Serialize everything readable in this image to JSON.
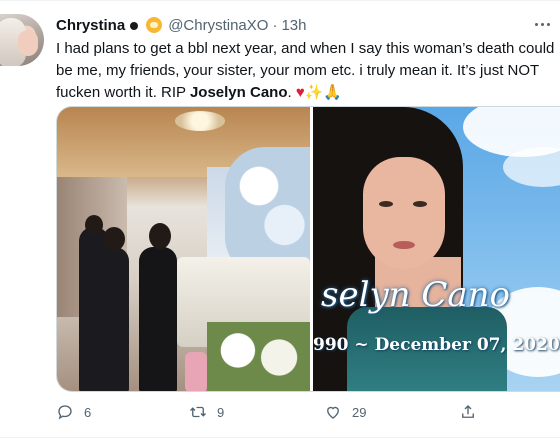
{
  "tweet": {
    "author_name": "Chrystina",
    "author_handle": "@ChrystinaXO",
    "separator": "·",
    "timestamp": "13h",
    "text_part1": "I had plans to get a bbl next year, and when I say this woman’s death could be me, my friends, your sister, your mom etc. i truly mean it. It’s just NOT fucken worth it. RIP ",
    "text_bold_name": "Joselyn Cano",
    "text_end": ". ",
    "emoji_heart": "♥",
    "emoji_sparkles": "✨",
    "emoji_pray": "🙏",
    "media": {
      "image2_overlay_name": "selyn Cano",
      "image2_overlay_dates": "990 ~ December 07, 2020"
    },
    "actions": {
      "reply_count": "6",
      "retweet_count": "9",
      "like_count": "29"
    },
    "icons": {
      "reply": "reply-icon",
      "retweet": "retweet-icon",
      "like": "like-icon",
      "share": "share-icon",
      "more": "more-icon"
    },
    "colors": {
      "heart": "#d8213b",
      "secondary_text": "#536471",
      "primary_text": "#0f1419"
    }
  }
}
